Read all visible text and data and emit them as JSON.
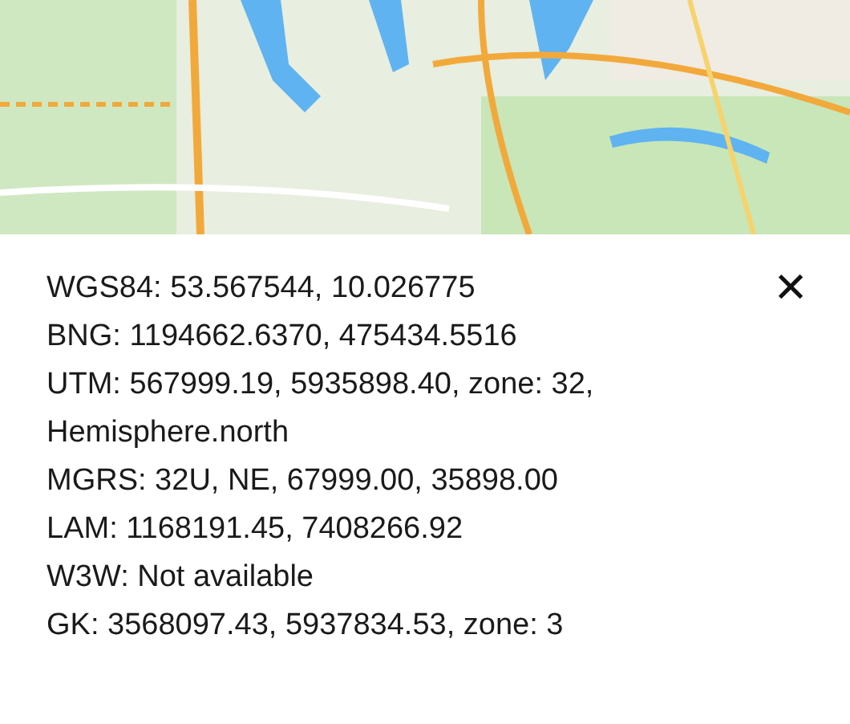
{
  "close_button": {
    "label": "✕"
  },
  "coordinates": [
    {
      "text": "WGS84: 53.567544, 10.026775"
    },
    {
      "text": "BNG: 1194662.6370, 475434.5516"
    },
    {
      "text": "UTM: 567999.19, 5935898.40, zone: 32, Hemisphere.north"
    },
    {
      "text": "MGRS: 32U, NE, 67999.00, 35898.00"
    },
    {
      "text": "LAM: 1168191.45, 7408266.92"
    },
    {
      "text": "W3W: Not available"
    },
    {
      "text": "GK: 3568097.43, 5937834.53, zone: 3"
    }
  ]
}
